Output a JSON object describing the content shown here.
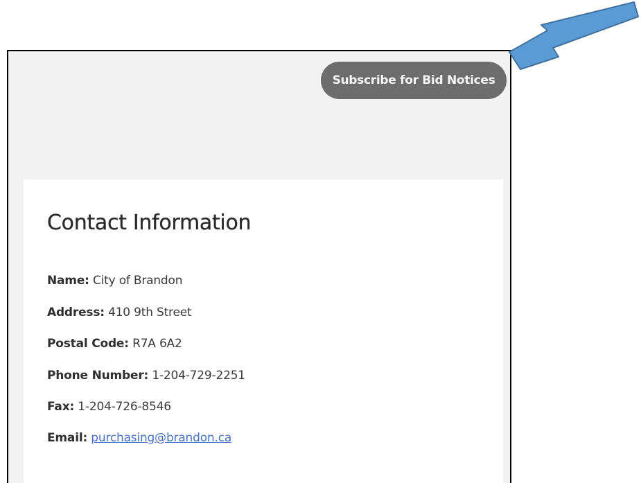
{
  "header": {
    "subscribe_label": "Subscribe for Bid Notices"
  },
  "contact": {
    "title": "Contact Information",
    "rows": [
      {
        "label": "Name:",
        "value": "City of Brandon"
      },
      {
        "label": "Address:",
        "value": "410 9th Street"
      },
      {
        "label": "Postal Code:",
        "value": "R7A 6A2"
      },
      {
        "label": "Phone Number:",
        "value": "1-204-729-2251"
      },
      {
        "label": "Fax:",
        "value": "1-204-726-8546"
      },
      {
        "label": "Email:",
        "value": "purchasing@brandon.ca"
      }
    ]
  },
  "annotation": {
    "arrow_color": "#5b9bd5",
    "arrow_icon": "arrow-pointer-icon"
  }
}
